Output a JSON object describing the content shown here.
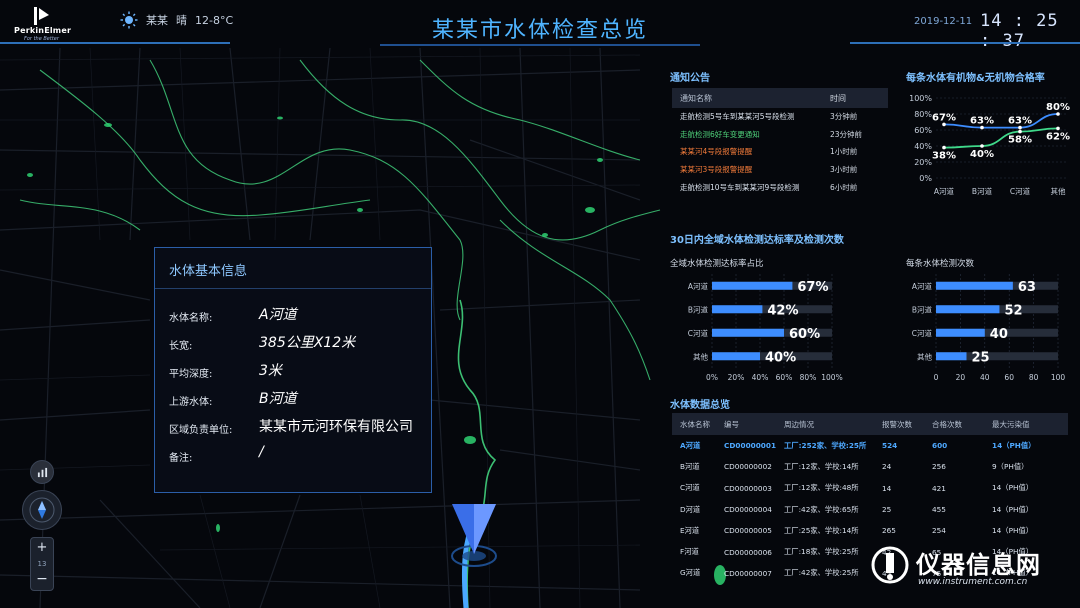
{
  "brand": {
    "name": "PerkinElmer",
    "tagline": "For the Better"
  },
  "weather": {
    "icon": "sun-icon",
    "city": "某某",
    "condition": "晴",
    "temperature": "12-8°C"
  },
  "title": "某某市水体检查总览",
  "date": "2019-12-11",
  "clock": "14 : 25 : 37",
  "info_panel": {
    "title": "水体基本信息",
    "rows": [
      {
        "label": "水体名称:",
        "value": "A河道"
      },
      {
        "label": "长宽:",
        "value": "385公里X12米"
      },
      {
        "label": "平均深度:",
        "value": "3米"
      },
      {
        "label": "上游水体:",
        "value": "B河道"
      },
      {
        "label": "区域负责单位:",
        "value": "某某市元河环保有限公司"
      },
      {
        "label": "备注:",
        "value": "/"
      }
    ]
  },
  "map_controls": {
    "chart_icon": "bar-chart-icon",
    "compass_icon": "compass-icon",
    "zoom_in": "+",
    "zoom_level": "13",
    "zoom_out": "−"
  },
  "notices": {
    "title": "通知公告",
    "col_name": "通知名称",
    "col_time": "时间",
    "rows": [
      {
        "name": "走航检测5号车到某某河5号段检测",
        "time": "3分钟前",
        "color": "#d9e1ec"
      },
      {
        "name": "走航检测6好车变更通知",
        "time": "23分钟前",
        "color": "#4fd17a"
      },
      {
        "name": "某某河4号段报警提醒",
        "time": "1小时前",
        "color": "#f07a3a"
      },
      {
        "name": "某某河3号段报警提醒",
        "time": "3小时前",
        "color": "#f07a3a"
      },
      {
        "name": "走航检测10号车到某某河9号段检测",
        "time": "6小时前",
        "color": "#d9e1ec"
      }
    ]
  },
  "organic_chart": {
    "title": "每条水体有机物&无机物合格率",
    "chart_data": {
      "type": "line",
      "categories": [
        "A河道",
        "B河道",
        "C河道",
        "其他"
      ],
      "yticks": [
        "100%",
        "80%",
        "60%",
        "40%",
        "20%",
        "0%"
      ],
      "ylim": [
        0,
        100
      ],
      "series": [
        {
          "values": [
            67,
            63,
            63,
            80
          ],
          "labels": [
            "67%",
            "63%",
            "63%",
            "80%"
          ],
          "color": "#3d8dff"
        },
        {
          "values": [
            38,
            40,
            58,
            62
          ],
          "labels": [
            "38%",
            "40%",
            "58%",
            "62%"
          ],
          "color": "#3fd98a"
        }
      ]
    }
  },
  "thirty_day": {
    "title": "30日内全域水体检测达标率及检测次数",
    "rate_chart": {
      "subtitle": "全域水体检测达标率占比",
      "chart_data": {
        "type": "bar",
        "categories": [
          "A河道",
          "B河道",
          "C河道",
          "其他"
        ],
        "values": [
          67,
          42,
          60,
          40
        ],
        "value_labels": [
          "67%",
          "42%",
          "60%",
          "40%"
        ],
        "xticks": [
          "0%",
          "20%",
          "40%",
          "60%",
          "80%",
          "100%"
        ],
        "xlim": [
          0,
          100
        ]
      }
    },
    "count_chart": {
      "subtitle": "每条水体检测次数",
      "chart_data": {
        "type": "bar",
        "categories": [
          "A河道",
          "B河道",
          "C河道",
          "其他"
        ],
        "values": [
          63,
          52,
          40,
          25
        ],
        "value_labels": [
          "63",
          "52",
          "40",
          "25"
        ],
        "xticks": [
          "0",
          "20",
          "40",
          "60",
          "80",
          "100"
        ],
        "xlim": [
          0,
          100
        ]
      }
    }
  },
  "data_table": {
    "title": "水体数据总览",
    "headers": [
      "水体名称",
      "编号",
      "周边情况",
      "报警次数",
      "合格次数",
      "最大污染值"
    ],
    "rows": [
      [
        "A河道",
        "CD00000001",
        "工厂:252家、学校:25所",
        "524",
        "600",
        "14（PH值）"
      ],
      [
        "B河道",
        "CD00000002",
        "工厂:12家、学校:14所",
        "24",
        "256",
        "9（PH值）"
      ],
      [
        "C河道",
        "CD00000003",
        "工厂:12家、学校:48所",
        "14",
        "421",
        "14（PH值）"
      ],
      [
        "D河道",
        "CD00000004",
        "工厂:42家、学校:65所",
        "25",
        "455",
        "14（PH值）"
      ],
      [
        "E河道",
        "CD00000005",
        "工厂:25家、学校:14所",
        "265",
        "254",
        "14（PH值）"
      ],
      [
        "F河道",
        "CD00000006",
        "工厂:18家、学校:25所",
        "42",
        "65",
        "14（PH值）"
      ],
      [
        "G河道",
        "CD00000007",
        "工厂:42家、学校:25所",
        "45",
        "75",
        "14（PH值）"
      ]
    ]
  },
  "watermark": {
    "name": "仪器信息网",
    "url": "www.instrument.com.cn"
  }
}
